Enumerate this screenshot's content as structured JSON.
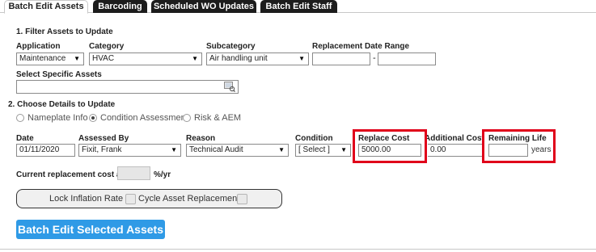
{
  "tabs": [
    {
      "label": "Batch Edit Assets",
      "active": true
    },
    {
      "label": "Barcoding",
      "active": false
    },
    {
      "label": "Scheduled WO Updates",
      "active": false
    },
    {
      "label": "Batch Edit Staff",
      "active": false
    }
  ],
  "filter": {
    "title": "1. Filter Assets to Update",
    "application_label": "Application",
    "application_value": "Maintenance",
    "category_label": "Category",
    "category_value": "HVAC",
    "subcategory_label": "Subcategory",
    "subcategory_value": "Air handling unit",
    "date_range_label": "Replacement Date Range",
    "date_range_from": "",
    "date_range_separator": "-",
    "date_range_to": "",
    "specific_assets_label": "Select Specific Assets",
    "specific_assets_value": ""
  },
  "details": {
    "title": "2. Choose Details to Update",
    "options": [
      {
        "label": "Nameplate Info",
        "checked": false
      },
      {
        "label": "Condition Assessment",
        "checked": true
      },
      {
        "label": "Risk & AEM",
        "checked": false
      }
    ],
    "date_label": "Date",
    "date_value": "01/11/2020",
    "assessed_by_label": "Assessed By",
    "assessed_by_value": "Fixit, Frank",
    "reason_label": "Reason",
    "reason_value": "Technical Audit",
    "condition_label": "Condition",
    "condition_value": "[ Select ]",
    "replace_cost_label": "Replace Cost",
    "replace_cost_value": "5000.00",
    "additional_cost_label": "Additional Cost",
    "additional_cost_value": "0.00",
    "remaining_life_label": "Remaining Life",
    "remaining_life_value": "",
    "remaining_life_unit": "years",
    "current_cost_label": "Current replacement cost at",
    "current_cost_value": "",
    "current_cost_unit": "%/yr",
    "lock_inflation_label": "Lock Inflation Rate",
    "cycle_replacement_label": "Cycle Asset Replacement"
  },
  "actions": {
    "batch_edit_label": "Batch Edit Selected Assets"
  },
  "colors": {
    "highlight": "#e0001a",
    "primary_button": "#2f9ae6",
    "tab_inactive": "#1c1c1c"
  }
}
